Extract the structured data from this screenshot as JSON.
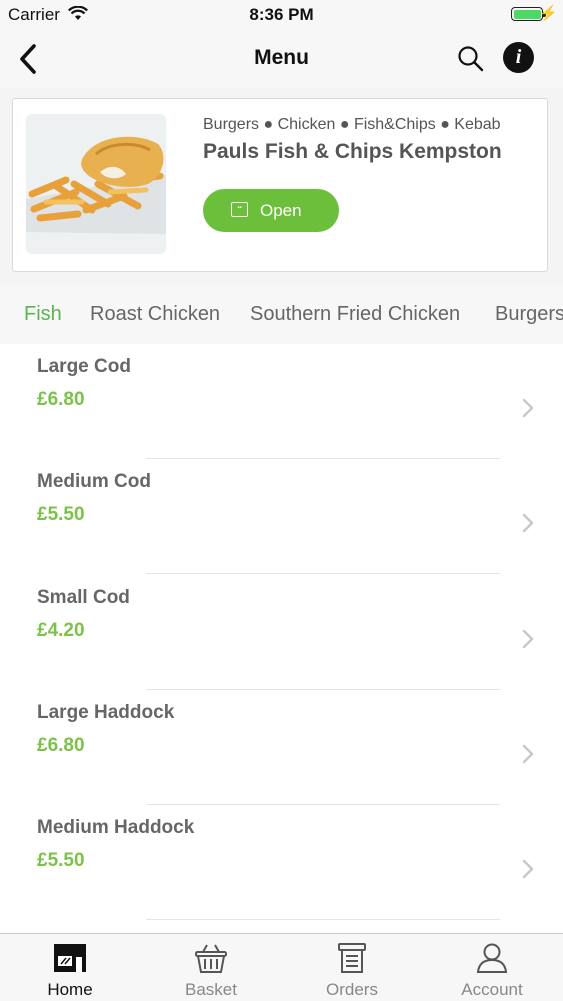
{
  "status_bar": {
    "carrier": "Carrier",
    "time": "8:36 PM"
  },
  "nav": {
    "title": "Menu"
  },
  "restaurant": {
    "categories": "Burgers ● Chicken ● Fish&Chips ● Kebab",
    "name": "Pauls Fish & Chips Kempston",
    "status_label": "Open",
    "accent_color": "#6cbf3a"
  },
  "menu_tabs": [
    {
      "label": "Fish",
      "active": true
    },
    {
      "label": "Roast Chicken",
      "active": false
    },
    {
      "label": "Southern Fried Chicken",
      "active": false
    },
    {
      "label": "Burgers",
      "active": false
    }
  ],
  "menu_items": [
    {
      "name": "Large Cod",
      "price": "£6.80"
    },
    {
      "name": "Medium Cod",
      "price": "£5.50"
    },
    {
      "name": "Small Cod",
      "price": "£4.20"
    },
    {
      "name": "Large Haddock",
      "price": "£6.80"
    },
    {
      "name": "Medium Haddock",
      "price": "£5.50"
    }
  ],
  "tab_bar": [
    {
      "label": "Home",
      "icon": "shop-icon",
      "active": true
    },
    {
      "label": "Basket",
      "icon": "basket-icon",
      "active": false
    },
    {
      "label": "Orders",
      "icon": "receipt-icon",
      "active": false
    },
    {
      "label": "Account",
      "icon": "person-icon",
      "active": false
    }
  ]
}
